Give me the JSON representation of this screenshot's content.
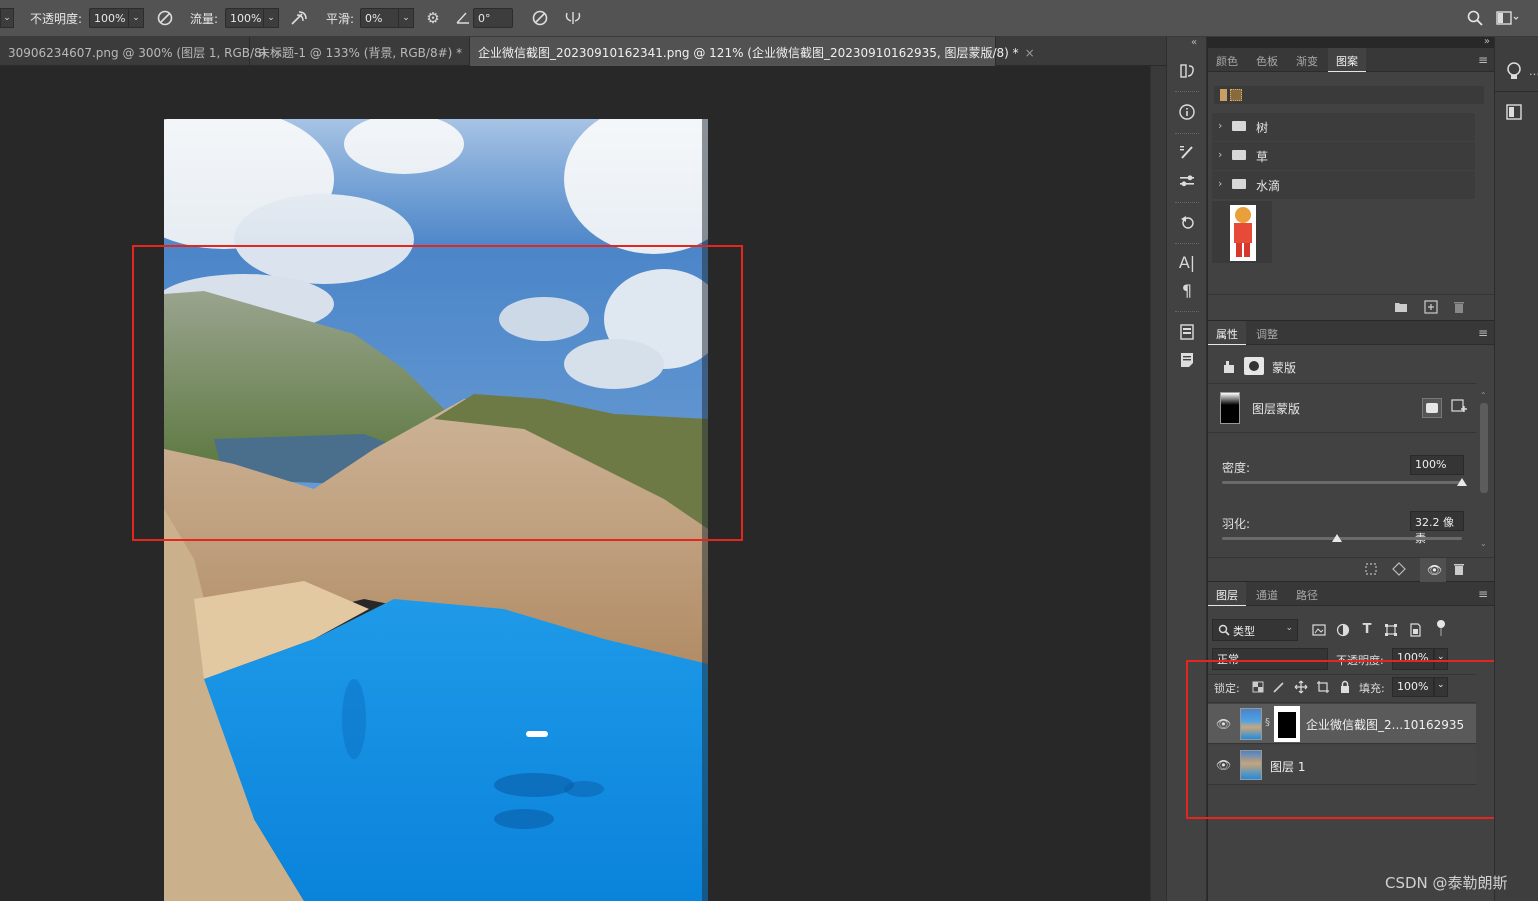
{
  "options_bar": {
    "opacity_label": "不透明度:",
    "opacity_value": "100%",
    "flow_label": "流量:",
    "flow_value": "100%",
    "smoothing_label": "平滑:",
    "smoothing_value": "0%",
    "angle_value": "0°"
  },
  "tabs": [
    {
      "label": "30906234607.png @ 300% (图层 1, RGB/8)",
      "close": "×"
    },
    {
      "label": "未标题-1 @ 133% (背景, RGB/8#) *",
      "close": "×"
    },
    {
      "label": "企业微信截图_20230910162341.png @ 121% (企业微信截图_20230910162935, 图层蒙版/8) *",
      "close": "×"
    }
  ],
  "patterns_panel": {
    "tabs": [
      "颜色",
      "色板",
      "渐变",
      "图案"
    ],
    "active_tab": "图案",
    "groups": [
      "树",
      "草",
      "水滴"
    ]
  },
  "properties_panel": {
    "tabs": [
      "属性",
      "调整"
    ],
    "active_tab": "属性",
    "mask_label": "蒙版",
    "layer_mask_label": "图层蒙版",
    "density_label": "密度:",
    "density_value": "100%",
    "density_level": 1.0,
    "feather_label": "羽化:",
    "feather_value": "32.2 像素",
    "feather_level": 0.48
  },
  "layers_panel": {
    "tabs": [
      "图层",
      "通道",
      "路径"
    ],
    "active_tab": "图层",
    "filter_kind": "类型",
    "blend_mode": "正常",
    "opacity_label": "不透明度:",
    "opacity_value": "100%",
    "lock_label": "锁定:",
    "fill_label": "填充:",
    "fill_value": "100%",
    "layers": [
      {
        "name": "企业微信截图_2...10162935",
        "selected": true
      },
      {
        "name": "图层 1",
        "selected": false
      }
    ]
  },
  "watermark": "CSDN @泰勒朗斯",
  "colors": {
    "highlight": "#e5261f",
    "ui_bg": "#424242",
    "canvas_bg": "#282828"
  }
}
